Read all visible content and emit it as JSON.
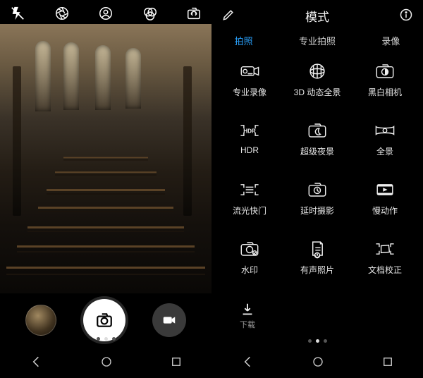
{
  "left": {
    "top_icons": [
      "flash-off-icon",
      "aperture-icon",
      "portrait-icon",
      "filters-icon",
      "switch-camera-icon"
    ],
    "page_indicator": {
      "count": 3,
      "active": 1
    }
  },
  "right": {
    "title": "模式",
    "edit_icon": "edit-icon",
    "info_icon": "info-icon",
    "tabs": [
      {
        "label": "拍照",
        "active": true
      },
      {
        "label": "专业拍照",
        "active": false
      },
      {
        "label": "录像",
        "active": false
      }
    ],
    "modes": [
      {
        "icon": "pro-video-icon",
        "label": "专业录像"
      },
      {
        "icon": "3d-pano-icon",
        "label": "3D 动态全景"
      },
      {
        "icon": "monochrome-icon",
        "label": "黑白相机"
      },
      {
        "icon": "hdr-icon",
        "label": "HDR"
      },
      {
        "icon": "night-icon",
        "label": "超级夜景"
      },
      {
        "icon": "panorama-icon",
        "label": "全景"
      },
      {
        "icon": "light-painting-icon",
        "label": "流光快门"
      },
      {
        "icon": "timelapse-icon",
        "label": "延时摄影"
      },
      {
        "icon": "slowmo-icon",
        "label": "慢动作"
      },
      {
        "icon": "watermark-icon",
        "label": "水印"
      },
      {
        "icon": "audio-note-icon",
        "label": "有声照片"
      },
      {
        "icon": "doc-scan-icon",
        "label": "文档校正"
      }
    ],
    "download_label": "下载",
    "page_indicator": {
      "count": 3,
      "active": 1
    }
  },
  "nav": {
    "items": [
      "nav-back-icon",
      "nav-home-icon",
      "nav-recent-icon"
    ]
  }
}
